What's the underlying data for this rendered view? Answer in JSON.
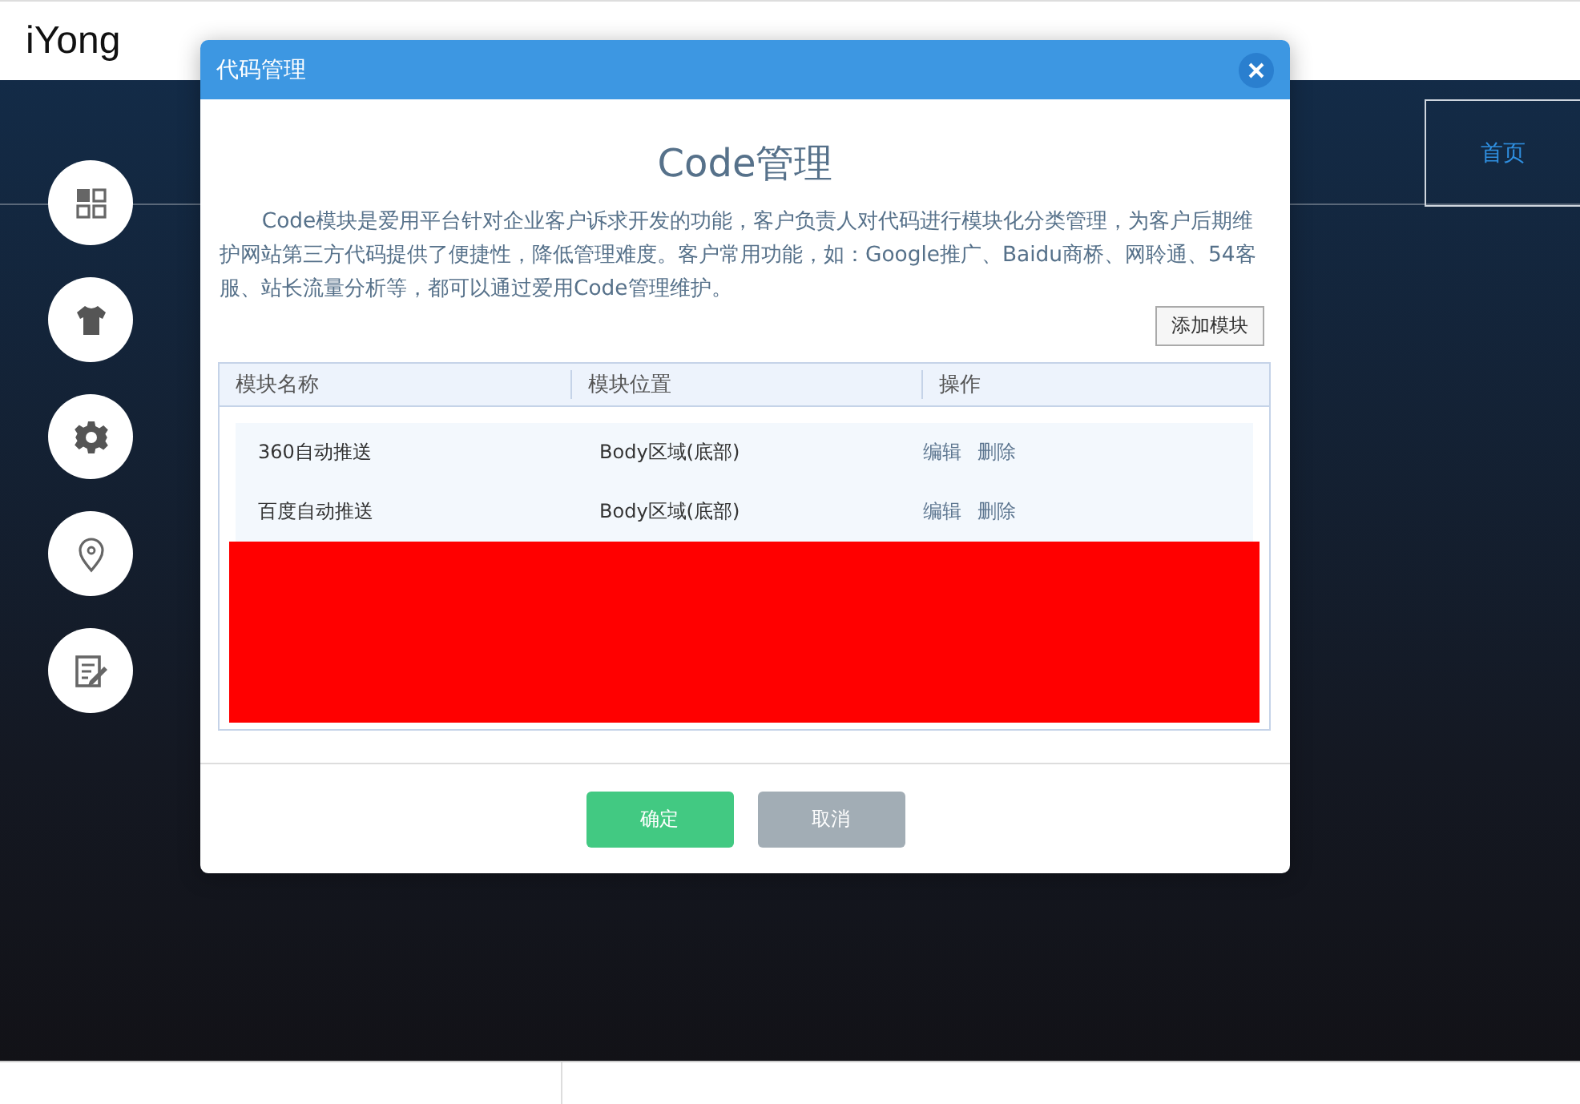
{
  "header": {
    "logo": "iYong"
  },
  "nav": [
    {
      "label": "首页",
      "selected": true
    }
  ],
  "dialog": {
    "title": "代码管理",
    "heading": "Code管理",
    "description": "Code模块是爱用平台针对企业客户诉求开发的功能，客户负责人对代码进行模块化分类管理，为客户后期维护网站第三方代码提供了便捷性，降低管理难度。客户常用功能，如：Google推广、Baidu商桥、网聆通、54客服、站长流量分析等，都可以通过爱用Code管理维护。",
    "add_button": "添加模块",
    "table": {
      "columns": [
        "模块名称",
        "模块位置",
        "操作"
      ],
      "rows": [
        {
          "name": "360自动推送",
          "position": "Body区域(底部)",
          "actions": [
            "编辑",
            "删除"
          ]
        },
        {
          "name": "百度自动推送",
          "position": "Body区域(底部)",
          "actions": [
            "编辑",
            "删除"
          ]
        }
      ]
    },
    "buttons": [
      {
        "label": "确定",
        "kind": "primary"
      },
      {
        "label": "取消",
        "kind": "secondary"
      }
    ]
  }
}
